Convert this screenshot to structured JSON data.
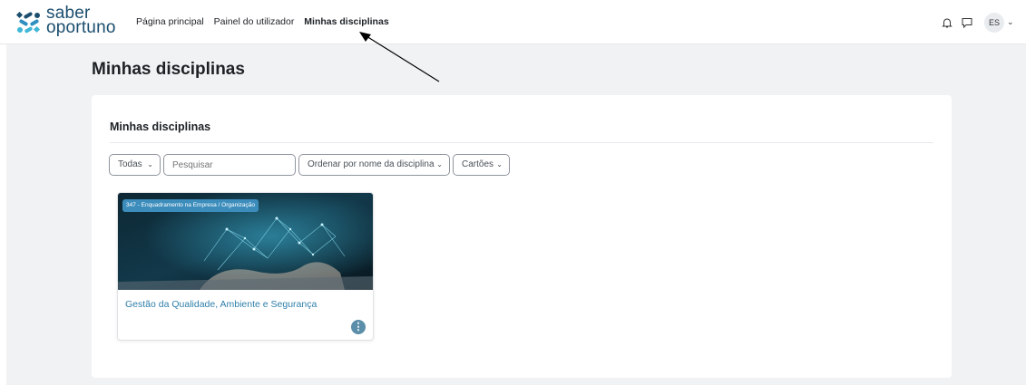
{
  "brand": {
    "line1": "saber",
    "line2": "oportuno"
  },
  "nav": {
    "links": [
      "Página principal",
      "Painel do utilizador",
      "Minhas disciplinas"
    ],
    "user_initials": "ES"
  },
  "page": {
    "title": "Minhas disciplinas"
  },
  "section": {
    "title": "Minhas disciplinas",
    "filter": "Todas",
    "search_placeholder": "Pesquisar",
    "sort": "Ordenar por nome da disciplina",
    "view": "Cartões"
  },
  "courses": [
    {
      "category": "347 - Enquadramento na Empresa / Organização",
      "name": "Gestão da Qualidade, Ambiente e Segurança"
    }
  ]
}
